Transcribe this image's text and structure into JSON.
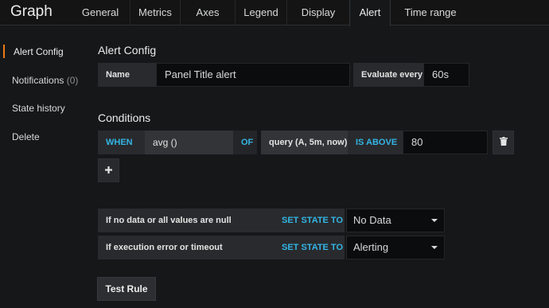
{
  "header": {
    "title": "Graph",
    "tabs": [
      {
        "label": "General"
      },
      {
        "label": "Metrics"
      },
      {
        "label": "Axes"
      },
      {
        "label": "Legend"
      },
      {
        "label": "Display"
      },
      {
        "label": "Alert",
        "active": true
      },
      {
        "label": "Time range"
      }
    ]
  },
  "sidebar": {
    "items": [
      {
        "label": "Alert Config",
        "active": true
      },
      {
        "label": "Notifications",
        "count": "(0)"
      },
      {
        "label": "State history"
      },
      {
        "label": "Delete"
      }
    ]
  },
  "alert_config": {
    "heading": "Alert Config",
    "name_label": "Name",
    "name_value": "Panel Title alert",
    "evaluate_label": "Evaluate every",
    "evaluate_value": "60s"
  },
  "conditions": {
    "heading": "Conditions",
    "when_label": "WHEN",
    "reducer": "avg ()",
    "of_label": "OF",
    "query": "query (A, 5m, now)",
    "evaluator": "IS ABOVE",
    "threshold": "80",
    "delete_icon": "trash-icon",
    "add_icon": "plus-icon"
  },
  "no_data": {
    "label": "If no data or all values are null",
    "set_state_label": "SET STATE TO",
    "value": "No Data"
  },
  "exec_error": {
    "label": "If execution error or timeout",
    "set_state_label": "SET STATE TO",
    "value": "Alerting"
  },
  "actions": {
    "test_rule_label": "Test Rule"
  },
  "colors": {
    "background": "#161719",
    "accent_blue": "#33b5e5",
    "active_marker": "#eb7b18"
  }
}
